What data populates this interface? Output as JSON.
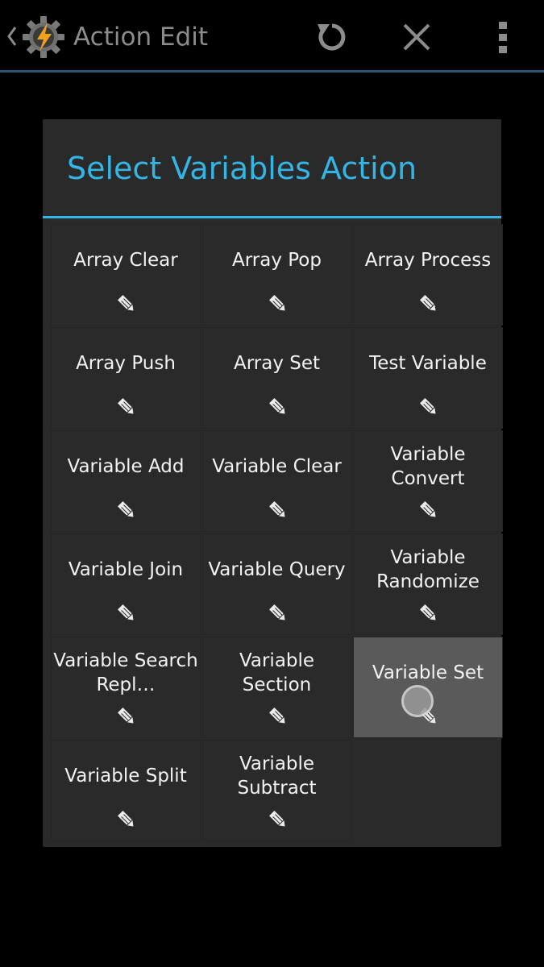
{
  "action_bar": {
    "title": "Action Edit",
    "icons": {
      "up": "chevron-left-icon",
      "app": "tasker-gear-bolt-icon",
      "reset": "refresh-icon",
      "close": "close-icon",
      "menu": "overflow-menu-icon"
    }
  },
  "dialog": {
    "title": "Select Variables Action",
    "accent_color": "#33b5e5",
    "items": [
      {
        "label": "Array Clear",
        "icon": "edit-icon"
      },
      {
        "label": "Array Pop",
        "icon": "edit-icon"
      },
      {
        "label": "Array Process",
        "icon": "edit-icon"
      },
      {
        "label": "Array Push",
        "icon": "edit-icon"
      },
      {
        "label": "Array Set",
        "icon": "edit-icon"
      },
      {
        "label": "Test Variable",
        "icon": "edit-icon"
      },
      {
        "label": "Variable Add",
        "icon": "edit-icon"
      },
      {
        "label": "Variable Clear",
        "icon": "edit-icon"
      },
      {
        "label": "Variable Convert",
        "icon": "edit-icon"
      },
      {
        "label": "Variable Join",
        "icon": "edit-icon"
      },
      {
        "label": "Variable Query",
        "icon": "edit-icon"
      },
      {
        "label": "Variable Randomize",
        "icon": "edit-icon"
      },
      {
        "label": "Variable Search Repl…",
        "icon": "edit-icon"
      },
      {
        "label": "Variable Section",
        "icon": "edit-icon"
      },
      {
        "label": "Variable Set",
        "icon": "edit-icon",
        "selected": true
      },
      {
        "label": "Variable Split",
        "icon": "edit-icon"
      },
      {
        "label": "Variable Subtract",
        "icon": "edit-icon"
      }
    ]
  }
}
